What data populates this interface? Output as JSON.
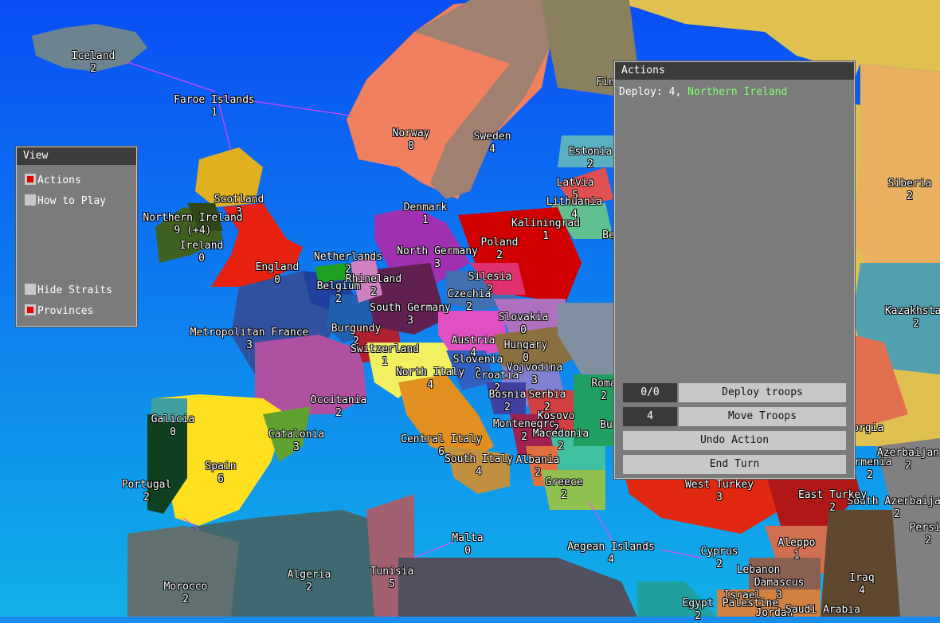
{
  "view_window": {
    "title": "View",
    "options": [
      {
        "label": "Actions",
        "checked": true
      },
      {
        "label": "How to Play",
        "checked": false
      },
      {
        "label": "Hide Straits",
        "checked": false
      },
      {
        "label": "Provinces",
        "checked": true
      }
    ]
  },
  "actions_window": {
    "title": "Actions",
    "log_prefix": "Deploy: 4,",
    "log_place": "Northern Ireland",
    "deploy_count": "0/0",
    "deploy_label": "Deploy troops",
    "move_count": "4",
    "move_label": "Move Troops",
    "undo_label": "Undo Action",
    "end_label": "End Turn"
  },
  "colors": {
    "ocean": "#1a8cf0",
    "panel": "#7b7b7b",
    "title_bar": "#3c3c3c",
    "checkbox_on": "#e00000",
    "log_place": "#80ff70"
  },
  "provinces": [
    {
      "name": "Iceland",
      "troops": "2"
    },
    {
      "name": "Faroe Islands",
      "troops": "1"
    },
    {
      "name": "Norway",
      "troops": "0"
    },
    {
      "name": "Sweden",
      "troops": "4"
    },
    {
      "name": "Estonia",
      "troops": "2"
    },
    {
      "name": "Latvia",
      "troops": "5"
    },
    {
      "name": "Lithuania",
      "troops": "4"
    },
    {
      "name": "Kaliningrad",
      "troops": "1"
    },
    {
      "name": "Scotland",
      "troops": "3"
    },
    {
      "name": "Northern Ireland",
      "troops": "9 (+4)"
    },
    {
      "name": "Ireland",
      "troops": "0"
    },
    {
      "name": "England",
      "troops": "0"
    },
    {
      "name": "Denmark",
      "troops": "1"
    },
    {
      "name": "North Germany",
      "troops": "3"
    },
    {
      "name": "Poland",
      "troops": "2"
    },
    {
      "name": "Netherlands",
      "troops": "2"
    },
    {
      "name": "Rhineland",
      "troops": "2"
    },
    {
      "name": "Belgium",
      "troops": "2"
    },
    {
      "name": "Silesia",
      "troops": "2"
    },
    {
      "name": "Czechia",
      "troops": "2"
    },
    {
      "name": "South Germany",
      "troops": "3"
    },
    {
      "name": "Slovakia",
      "troops": "0"
    },
    {
      "name": "Metropolitan France",
      "troops": "3"
    },
    {
      "name": "Burgundy",
      "troops": "2"
    },
    {
      "name": "Switzerland",
      "troops": "1"
    },
    {
      "name": "Austria",
      "troops": "4"
    },
    {
      "name": "Hungary",
      "troops": "0"
    },
    {
      "name": "Slovenia",
      "troops": "2"
    },
    {
      "name": "North Italy",
      "troops": "4"
    },
    {
      "name": "Croatia",
      "troops": "2"
    },
    {
      "name": "Vojvodina",
      "troops": "3"
    },
    {
      "name": "Occitania",
      "troops": "2"
    },
    {
      "name": "Bosnia",
      "troops": "2"
    },
    {
      "name": "Serbia",
      "troops": "2"
    },
    {
      "name": "Galicia",
      "troops": "0"
    },
    {
      "name": "Montenegro",
      "troops": "2"
    },
    {
      "name": "Kosovo",
      "troops": "2"
    },
    {
      "name": "Catalonia",
      "troops": "3"
    },
    {
      "name": "Macedonia",
      "troops": "2"
    },
    {
      "name": "Central Italy",
      "troops": "6"
    },
    {
      "name": "Spain",
      "troops": "6"
    },
    {
      "name": "South Italy",
      "troops": "4"
    },
    {
      "name": "Albania",
      "troops": "2"
    },
    {
      "name": "Portugal",
      "troops": "2"
    },
    {
      "name": "Greece",
      "troops": "2"
    },
    {
      "name": "Malta",
      "troops": "0"
    },
    {
      "name": "Aegean Islands",
      "troops": "4"
    },
    {
      "name": "Morocco",
      "troops": "2"
    },
    {
      "name": "Algeria",
      "troops": "2"
    },
    {
      "name": "Tunisia",
      "troops": "5"
    },
    {
      "name": "Siberia",
      "troops": "2"
    },
    {
      "name": "Kazakhstan",
      "troops": "2"
    },
    {
      "name": "Azerbaijan",
      "troops": "2"
    },
    {
      "name": "South Azerbaijan",
      "troops": "2"
    },
    {
      "name": "Persia",
      "troops": "2"
    },
    {
      "name": "Armenia",
      "troops": "2"
    },
    {
      "name": "Georgia",
      "troops": ""
    },
    {
      "name": "West Turkey",
      "troops": "3"
    },
    {
      "name": "East Turkey",
      "troops": "2"
    },
    {
      "name": "Aleppo",
      "troops": "1"
    },
    {
      "name": "Cyprus",
      "troops": "2"
    },
    {
      "name": "Lebanon",
      "troops": "2"
    },
    {
      "name": "Damascus",
      "troops": "3"
    },
    {
      "name": "Iraq",
      "troops": "4"
    },
    {
      "name": "Israel",
      "troops": ""
    },
    {
      "name": "Palestine",
      "troops": ""
    },
    {
      "name": "Egypt",
      "troops": "2"
    },
    {
      "name": "Jordan",
      "troops": ""
    },
    {
      "name": "Saudi Arabia",
      "troops": ""
    },
    {
      "name": "Fin",
      "troops": ""
    },
    {
      "name": "Roma",
      "troops": "2"
    },
    {
      "name": "Bu",
      "troops": ""
    },
    {
      "name": "Be",
      "troops": ""
    }
  ]
}
